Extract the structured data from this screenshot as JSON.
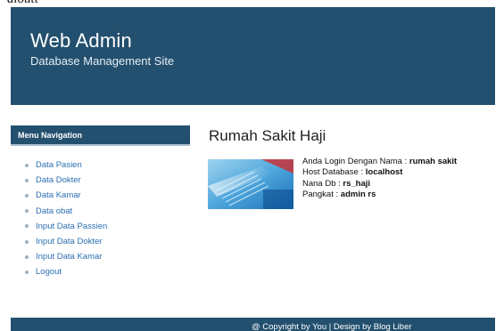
{
  "doc_fragment": "aloutt",
  "header": {
    "title": "Web Admin",
    "subtitle": "Database Management Site"
  },
  "nav": {
    "title": "Menu Navigation",
    "items": [
      {
        "label": "Data Pasien"
      },
      {
        "label": "Data Dokter"
      },
      {
        "label": "Data Kamar"
      },
      {
        "label": "Data obat"
      },
      {
        "label": "Input Data Passien"
      },
      {
        "label": "Input Data Dokter"
      },
      {
        "label": "Input Data Kamar"
      },
      {
        "label": "Logout"
      }
    ]
  },
  "main": {
    "title": "Rumah Sakit Haji",
    "info": {
      "login_label": "Anda Login Dengan Nama : ",
      "login_value": "rumah sakit",
      "host_label": "Host Database : ",
      "host_value": "localhost",
      "db_label": "Nana Db : ",
      "db_value": "rs_haji",
      "rank_label": "Pangkat : ",
      "rank_value": "admin rs"
    }
  },
  "footer": {
    "text": "@ Copyright by You | Design by Blog Liber"
  },
  "colors": {
    "primary": "#23506e",
    "link": "#2a6fb0"
  }
}
